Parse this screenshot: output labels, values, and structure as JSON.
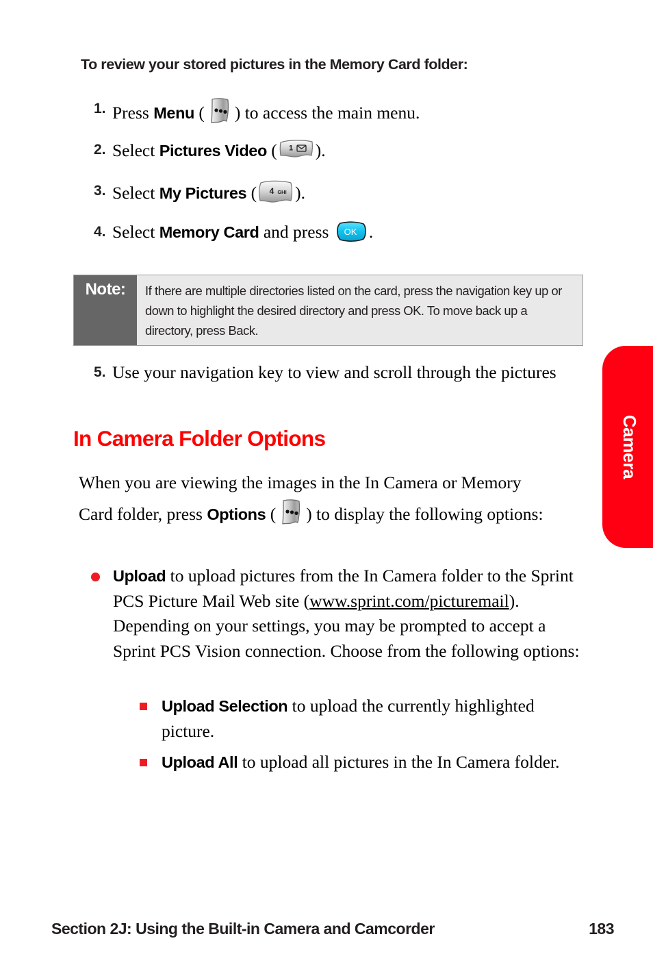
{
  "page": {
    "intro_heading": "To review your stored pictures in the Memory Card folder:",
    "section_heading": "In Camera Folder Options"
  },
  "steps": [
    {
      "number": "1.",
      "pre": "Press ",
      "bold": "Menu",
      "mid": " (",
      "icon": "softkey-menu-icon",
      "post": ") to access the main menu."
    },
    {
      "number": "2.",
      "pre": "Select ",
      "bold": "Pictures Video",
      "mid": " (",
      "icon": "key-1-message-icon",
      "post": ")."
    },
    {
      "number": "3.",
      "pre": "Select ",
      "bold": "My Pictures",
      "mid": " (",
      "icon": "key-4-ghi-icon",
      "post": ")."
    },
    {
      "number": "4.",
      "pre": "Select ",
      "bold": "Memory Card",
      "mid": " and press ",
      "icon": "ok-button-icon",
      "post": "."
    },
    {
      "number": "5.",
      "pre": "Use your navigation key to view and scroll through the pictures",
      "bold": "",
      "mid": "",
      "icon": "",
      "post": ""
    }
  ],
  "note": {
    "label": "Note:",
    "text": "If there are multiple directories listed on the card, press the navigation key up or down to highlight the desired directory and press OK. To move back up a directory, press Back."
  },
  "intro_paragraph": {
    "part1": "When you are viewing the images in the In Camera or Memory Card folder, press ",
    "bold": "Options",
    "part2": " (",
    "icon": "softkey-options-icon",
    "part3": ") to display the following options:"
  },
  "bullets": {
    "upload": {
      "bold": "Upload",
      "text_before_link": " to upload pictures from the In Camera folder to the Sprint PCS Picture Mail Web site (",
      "link": "www.sprint.com/picturemail",
      "text_after_link": "). Depending on your settings, you may be prompted to accept a Sprint PCS Vision connection. Choose from the following options:"
    },
    "upload_selection": {
      "bold": "Upload Selection",
      "text": " to upload the currently highlighted picture."
    },
    "upload_all": {
      "bold": "Upload All",
      "text": " to upload all pictures in the In Camera folder."
    }
  },
  "side_tab": {
    "label": "Camera",
    "color": "#ff0013"
  },
  "footer": {
    "section": "Section 2J: Using the Built-in Camera and Camcorder",
    "page_number": "183"
  },
  "colors": {
    "heading_red": "#ff0000",
    "bullet_red": "#ed1c24",
    "note_label_bg": "#666666",
    "note_body_bg": "#e9e9e9",
    "ok_button": "#13c2ef"
  },
  "icons": {
    "key_1_digit": "1",
    "key_4_digit": "4",
    "key_4_letters": "GHI",
    "ok_label": "OK"
  }
}
